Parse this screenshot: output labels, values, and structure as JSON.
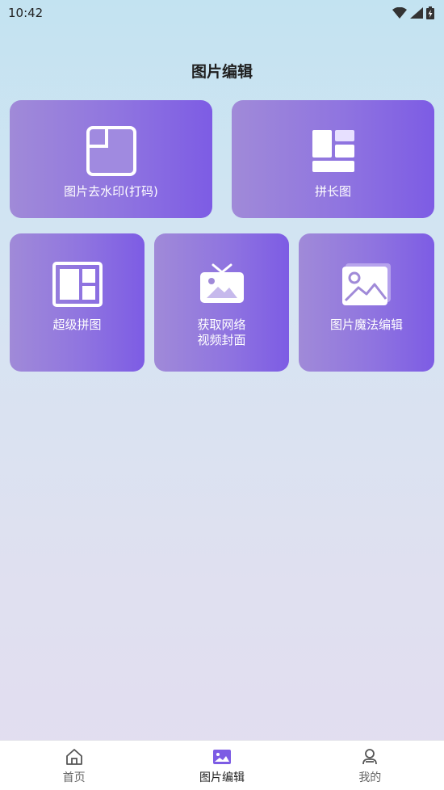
{
  "status_bar": {
    "time": "10:42",
    "icons": [
      "wifi-icon",
      "signal-icon",
      "battery-charging-icon"
    ]
  },
  "page": {
    "title": "图片编辑"
  },
  "tiles": [
    {
      "label": "图片去水印(打码)",
      "icon": "watermark-remove-icon"
    },
    {
      "label": "拼长图",
      "icon": "long-image-icon"
    },
    {
      "label": "超级拼图",
      "icon": "collage-icon"
    },
    {
      "label_lines": [
        "获取网络",
        "视频封面"
      ],
      "icon": "tv-cover-icon"
    },
    {
      "label": "图片魔法编辑",
      "icon": "picture-magic-icon"
    }
  ],
  "bottom_nav": {
    "active_index": 1,
    "active_color": "#7d5ce4",
    "items": [
      {
        "label": "首页",
        "icon": "home-icon"
      },
      {
        "label": "图片编辑",
        "icon": "image-edit-icon"
      },
      {
        "label": "我的",
        "icon": "profile-icon"
      }
    ]
  }
}
